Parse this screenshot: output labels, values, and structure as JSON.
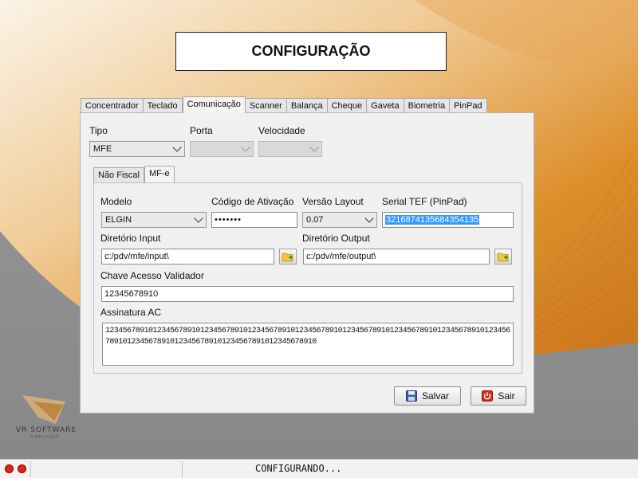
{
  "page_title": "CONFIGURAÇÃO",
  "tabs": [
    "Concentrador",
    "Teclado",
    "Comunicação",
    "Scanner",
    "Balança",
    "Cheque",
    "Gaveta",
    "Biometria",
    "PinPad"
  ],
  "active_tab": "Comunicação",
  "tipo": {
    "label": "Tipo",
    "value": "MFE"
  },
  "porta": {
    "label": "Porta",
    "value": ""
  },
  "velocidade": {
    "label": "Velocidade",
    "value": ""
  },
  "inner_tabs": [
    "Não Fiscal",
    "MF-e"
  ],
  "inner_active_tab": "MF-e",
  "modelo": {
    "label": "Modelo",
    "value": "ELGIN"
  },
  "codigo_ativacao": {
    "label": "Código de Ativação",
    "value": "•••••••"
  },
  "versao_layout": {
    "label": "Versão Layout",
    "value": "0.07"
  },
  "serial_tef": {
    "label": "Serial TEF (PinPad)",
    "value": "3216874135684354135"
  },
  "diretorio_input": {
    "label": "Diretório Input",
    "value": "c:/pdv/mfe/input\\"
  },
  "diretorio_output": {
    "label": "Diretório Output",
    "value": "c:/pdv/mfe/output\\"
  },
  "chave_acesso": {
    "label": "Chave Acesso Validador",
    "value": "12345678910"
  },
  "assinatura": {
    "label": "Assinatura AC",
    "value": "12345678910123456789101234567891012345678910123456789101234567891012345678910123456789101234567891012345678910123456789101234567891012345678910"
  },
  "buttons": {
    "salvar": "Salvar",
    "sair": "Sair"
  },
  "status": {
    "text": "CONFIGURANDO..."
  },
  "logo": {
    "name": "VR SOFTWARE",
    "tagline": "SIMPLIFIQUE"
  },
  "colors": {
    "selection": "#3399ff",
    "background_orange": "#d98a1e",
    "background_gray": "#8a8a8a"
  }
}
